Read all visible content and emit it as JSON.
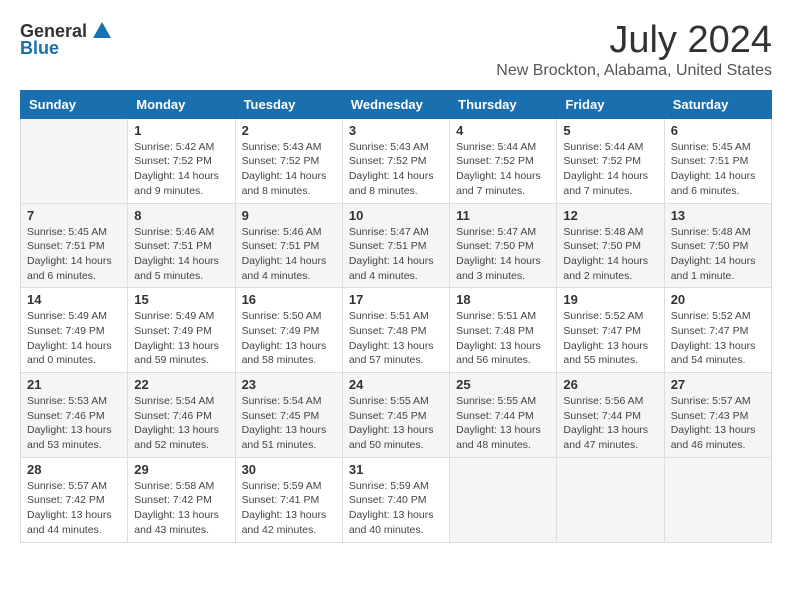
{
  "header": {
    "logo_general": "General",
    "logo_blue": "Blue",
    "month_year": "July 2024",
    "location": "New Brockton, Alabama, United States"
  },
  "weekdays": [
    "Sunday",
    "Monday",
    "Tuesday",
    "Wednesday",
    "Thursday",
    "Friday",
    "Saturday"
  ],
  "weeks": [
    [
      {
        "day": "",
        "info": ""
      },
      {
        "day": "1",
        "info": "Sunrise: 5:42 AM\nSunset: 7:52 PM\nDaylight: 14 hours\nand 9 minutes."
      },
      {
        "day": "2",
        "info": "Sunrise: 5:43 AM\nSunset: 7:52 PM\nDaylight: 14 hours\nand 8 minutes."
      },
      {
        "day": "3",
        "info": "Sunrise: 5:43 AM\nSunset: 7:52 PM\nDaylight: 14 hours\nand 8 minutes."
      },
      {
        "day": "4",
        "info": "Sunrise: 5:44 AM\nSunset: 7:52 PM\nDaylight: 14 hours\nand 7 minutes."
      },
      {
        "day": "5",
        "info": "Sunrise: 5:44 AM\nSunset: 7:52 PM\nDaylight: 14 hours\nand 7 minutes."
      },
      {
        "day": "6",
        "info": "Sunrise: 5:45 AM\nSunset: 7:51 PM\nDaylight: 14 hours\nand 6 minutes."
      }
    ],
    [
      {
        "day": "7",
        "info": "Sunrise: 5:45 AM\nSunset: 7:51 PM\nDaylight: 14 hours\nand 6 minutes."
      },
      {
        "day": "8",
        "info": "Sunrise: 5:46 AM\nSunset: 7:51 PM\nDaylight: 14 hours\nand 5 minutes."
      },
      {
        "day": "9",
        "info": "Sunrise: 5:46 AM\nSunset: 7:51 PM\nDaylight: 14 hours\nand 4 minutes."
      },
      {
        "day": "10",
        "info": "Sunrise: 5:47 AM\nSunset: 7:51 PM\nDaylight: 14 hours\nand 4 minutes."
      },
      {
        "day": "11",
        "info": "Sunrise: 5:47 AM\nSunset: 7:50 PM\nDaylight: 14 hours\nand 3 minutes."
      },
      {
        "day": "12",
        "info": "Sunrise: 5:48 AM\nSunset: 7:50 PM\nDaylight: 14 hours\nand 2 minutes."
      },
      {
        "day": "13",
        "info": "Sunrise: 5:48 AM\nSunset: 7:50 PM\nDaylight: 14 hours\nand 1 minute."
      }
    ],
    [
      {
        "day": "14",
        "info": "Sunrise: 5:49 AM\nSunset: 7:49 PM\nDaylight: 14 hours\nand 0 minutes."
      },
      {
        "day": "15",
        "info": "Sunrise: 5:49 AM\nSunset: 7:49 PM\nDaylight: 13 hours\nand 59 minutes."
      },
      {
        "day": "16",
        "info": "Sunrise: 5:50 AM\nSunset: 7:49 PM\nDaylight: 13 hours\nand 58 minutes."
      },
      {
        "day": "17",
        "info": "Sunrise: 5:51 AM\nSunset: 7:48 PM\nDaylight: 13 hours\nand 57 minutes."
      },
      {
        "day": "18",
        "info": "Sunrise: 5:51 AM\nSunset: 7:48 PM\nDaylight: 13 hours\nand 56 minutes."
      },
      {
        "day": "19",
        "info": "Sunrise: 5:52 AM\nSunset: 7:47 PM\nDaylight: 13 hours\nand 55 minutes."
      },
      {
        "day": "20",
        "info": "Sunrise: 5:52 AM\nSunset: 7:47 PM\nDaylight: 13 hours\nand 54 minutes."
      }
    ],
    [
      {
        "day": "21",
        "info": "Sunrise: 5:53 AM\nSunset: 7:46 PM\nDaylight: 13 hours\nand 53 minutes."
      },
      {
        "day": "22",
        "info": "Sunrise: 5:54 AM\nSunset: 7:46 PM\nDaylight: 13 hours\nand 52 minutes."
      },
      {
        "day": "23",
        "info": "Sunrise: 5:54 AM\nSunset: 7:45 PM\nDaylight: 13 hours\nand 51 minutes."
      },
      {
        "day": "24",
        "info": "Sunrise: 5:55 AM\nSunset: 7:45 PM\nDaylight: 13 hours\nand 50 minutes."
      },
      {
        "day": "25",
        "info": "Sunrise: 5:55 AM\nSunset: 7:44 PM\nDaylight: 13 hours\nand 48 minutes."
      },
      {
        "day": "26",
        "info": "Sunrise: 5:56 AM\nSunset: 7:44 PM\nDaylight: 13 hours\nand 47 minutes."
      },
      {
        "day": "27",
        "info": "Sunrise: 5:57 AM\nSunset: 7:43 PM\nDaylight: 13 hours\nand 46 minutes."
      }
    ],
    [
      {
        "day": "28",
        "info": "Sunrise: 5:57 AM\nSunset: 7:42 PM\nDaylight: 13 hours\nand 44 minutes."
      },
      {
        "day": "29",
        "info": "Sunrise: 5:58 AM\nSunset: 7:42 PM\nDaylight: 13 hours\nand 43 minutes."
      },
      {
        "day": "30",
        "info": "Sunrise: 5:59 AM\nSunset: 7:41 PM\nDaylight: 13 hours\nand 42 minutes."
      },
      {
        "day": "31",
        "info": "Sunrise: 5:59 AM\nSunset: 7:40 PM\nDaylight: 13 hours\nand 40 minutes."
      },
      {
        "day": "",
        "info": ""
      },
      {
        "day": "",
        "info": ""
      },
      {
        "day": "",
        "info": ""
      }
    ]
  ]
}
